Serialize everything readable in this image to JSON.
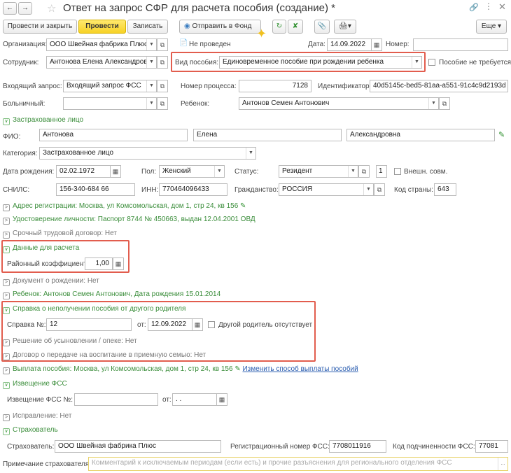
{
  "title": "Ответ на запрос СФР для расчета пособия (создание) *",
  "toolbar": {
    "post_close": "Провести и закрыть",
    "post": "Провести",
    "save": "Записать",
    "send": "Отправить в Фонд",
    "more": "Еще"
  },
  "header": {
    "org_label": "Организация:",
    "org_value": "ООО Швейная фабрика Плюс",
    "status": "Не проведен",
    "date_label": "Дата:",
    "date_value": "14.09.2022",
    "number_label": "Номер:",
    "number_value": "",
    "employee_label": "Сотрудник:",
    "employee_value": "Антонова Елена Александровна",
    "benefit_type_label": "Вид пособия:",
    "benefit_type_value": "Единовременное пособие при рождении ребенка",
    "not_required": "Пособие не требуется",
    "request_label": "Входящий запрос:",
    "request_value": "Входящий запрос ФСС",
    "process_label": "Номер процесса:",
    "process_value": "7128",
    "id_label": "Идентификатор:",
    "id_value": "40d5145c-bed5-81aa-a551-91c4c9d2193d",
    "sick_label": "Больничный:",
    "sick_value": "",
    "child_label": "Ребенок:",
    "child_value": "Антонов Семен Антонович"
  },
  "insured": {
    "section": "Застрахованное лицо",
    "fio_label": "ФИО:",
    "last": "Антонова",
    "first": "Елена",
    "middle": "Александровна",
    "category_label": "Категория:",
    "category_value": "Застрахованное лицо",
    "birth_label": "Дата рождения:",
    "birth_value": "02.02.1972",
    "sex_label": "Пол:",
    "sex_value": "Женский",
    "status_label": "Статус:",
    "status_value": "Резидент",
    "status_num": "1",
    "ext_label": "Внешн. совм.",
    "snils_label": "СНИЛС:",
    "snils_value": "156-340-684 66",
    "inn_label": "ИНН:",
    "inn_value": "770464096433",
    "citizen_label": "Гражданство:",
    "citizen_value": "РОССИЯ",
    "country_label": "Код страны:",
    "country_value": "643"
  },
  "sections": {
    "address": "Адрес регистрации: Москва, ул Комсомольская, дом 1, стр 24, кв 156",
    "identity": "Удостоверение личности: Паспорт 8744 № 450663, выдан 12.04.2001 ОВД",
    "contract": "Срочный трудовой договор: Нет",
    "calc": "Данные для расчета",
    "coef_label": "Районный коэффициент:",
    "coef_value": "1,00",
    "birth_doc": "Документ о рождении: Нет",
    "child": "Ребенок: Антонов Семен Антонович, Дата рождения 15.01.2014",
    "cert": "Справка о неполучении пособия от другого родителя",
    "cert_num_label": "Справка №:",
    "cert_num_value": "12",
    "cert_from_label": "от:",
    "cert_from_value": "12.09.2022",
    "other_parent": "Другой родитель отсутствует",
    "adoption": "Решение об усыновлении / опеке: Нет",
    "foster": "Договор о передаче на воспитание в приемную семью: Нет",
    "payment": "Выплата пособия: Москва, ул Комсомольская, дом 1, стр 24, кв 156",
    "payment_link": "Изменить способ выплаты пособий",
    "notice": "Извещение ФСС",
    "notice_num_label": "Извещение ФСС №:",
    "notice_num_value": "",
    "notice_from_label": "от:",
    "notice_from_value": " .  .",
    "fix": "Исправление: Нет",
    "insurer": "Страхователь",
    "insurer_label": "Страхователь:",
    "insurer_value": "ООО Швейная фабрика Плюс",
    "reg_label": "Регистрационный номер ФСС:",
    "reg_value": "7708011916",
    "sub_label": "Код подчиненности ФСС:",
    "sub_value": "77081",
    "note_label": "Примечание страхователя:",
    "note_placeholder": "Комментарий к исключаемым периодам (если есть) и прочие разъяснения для регионального отделения ФСС"
  }
}
